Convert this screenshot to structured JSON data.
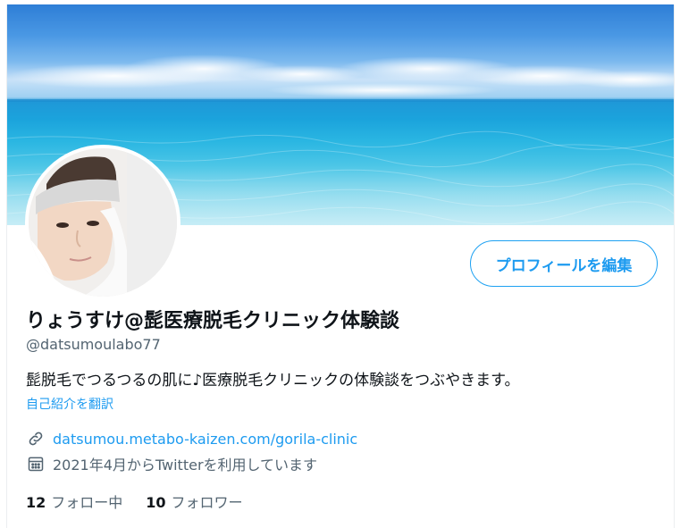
{
  "profile": {
    "display_name": "りょうすけ@髭医療脱毛クリニック体験談",
    "handle": "@datsumoulabo77",
    "bio": "髭脱毛でつるつるの肌に♪医療脱毛クリニックの体験談をつぶやきます。",
    "translate_bio": "自己紹介を翻訳",
    "website": "datsumou.metabo-kaizen.com/gorila-clinic",
    "joined": "2021年4月からTwitterを利用しています",
    "following_count": "12",
    "following_label": "フォロー中",
    "followers_count": "10",
    "followers_label": "フォロワー"
  },
  "actions": {
    "edit_profile": "プロフィールを編集"
  },
  "icons": {
    "website": "link-icon",
    "joined": "calendar-icon"
  },
  "colors": {
    "accent": "#1d9bf0",
    "text_primary": "#0f1419",
    "text_secondary": "#536471"
  }
}
